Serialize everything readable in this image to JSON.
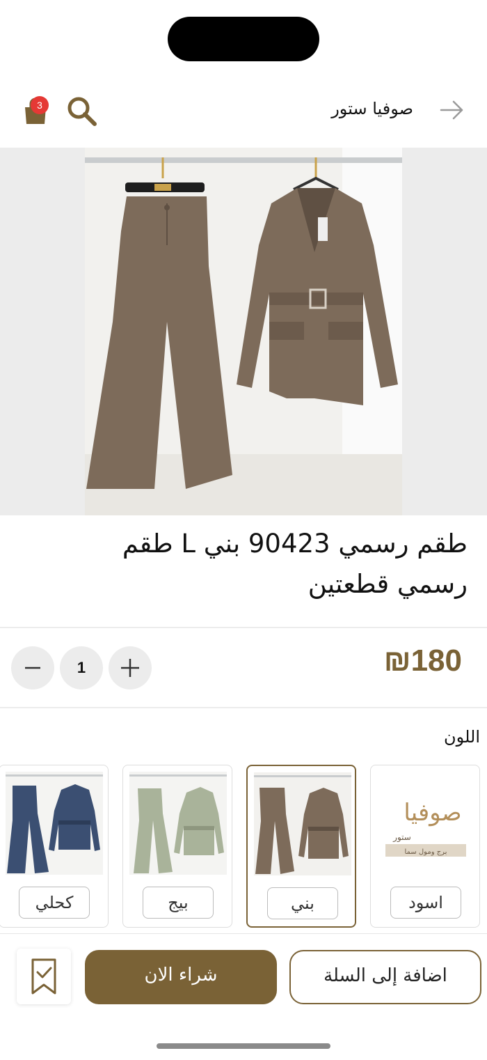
{
  "header": {
    "store_name": "صوفيا ستور",
    "cart_count": "3",
    "icons": {
      "back": "arrow-right-icon",
      "search": "search-icon",
      "cart": "shopping-bag-icon"
    }
  },
  "product": {
    "title": "طقم رسمي 90423 بني L طقم رسمي قطعتين",
    "price": "180",
    "currency_symbol": "₪",
    "quantity": "1"
  },
  "color_section": {
    "label": "اللون",
    "options": [
      {
        "label": "اسود",
        "selected": false,
        "image": "store-logo",
        "logo_text": "صوفيا",
        "logo_sub": "ستور",
        "logo_tagline": "برج ومول سما"
      },
      {
        "label": "بني",
        "selected": true,
        "image": "brown-suit"
      },
      {
        "label": "بيج",
        "selected": false,
        "image": "beige-suit"
      },
      {
        "label": "كحلي",
        "selected": false,
        "image": "navy-suit"
      }
    ]
  },
  "actions": {
    "add_to_cart": "اضافة إلى السلة",
    "buy_now": "شراء الان",
    "save_icon": "bookmark-check-icon"
  },
  "colors": {
    "accent": "#7a6236",
    "badge": "#e53935",
    "suit_brown": "#7d6b5a",
    "suit_beige": "#a9b39a",
    "suit_navy": "#3b4f72"
  }
}
